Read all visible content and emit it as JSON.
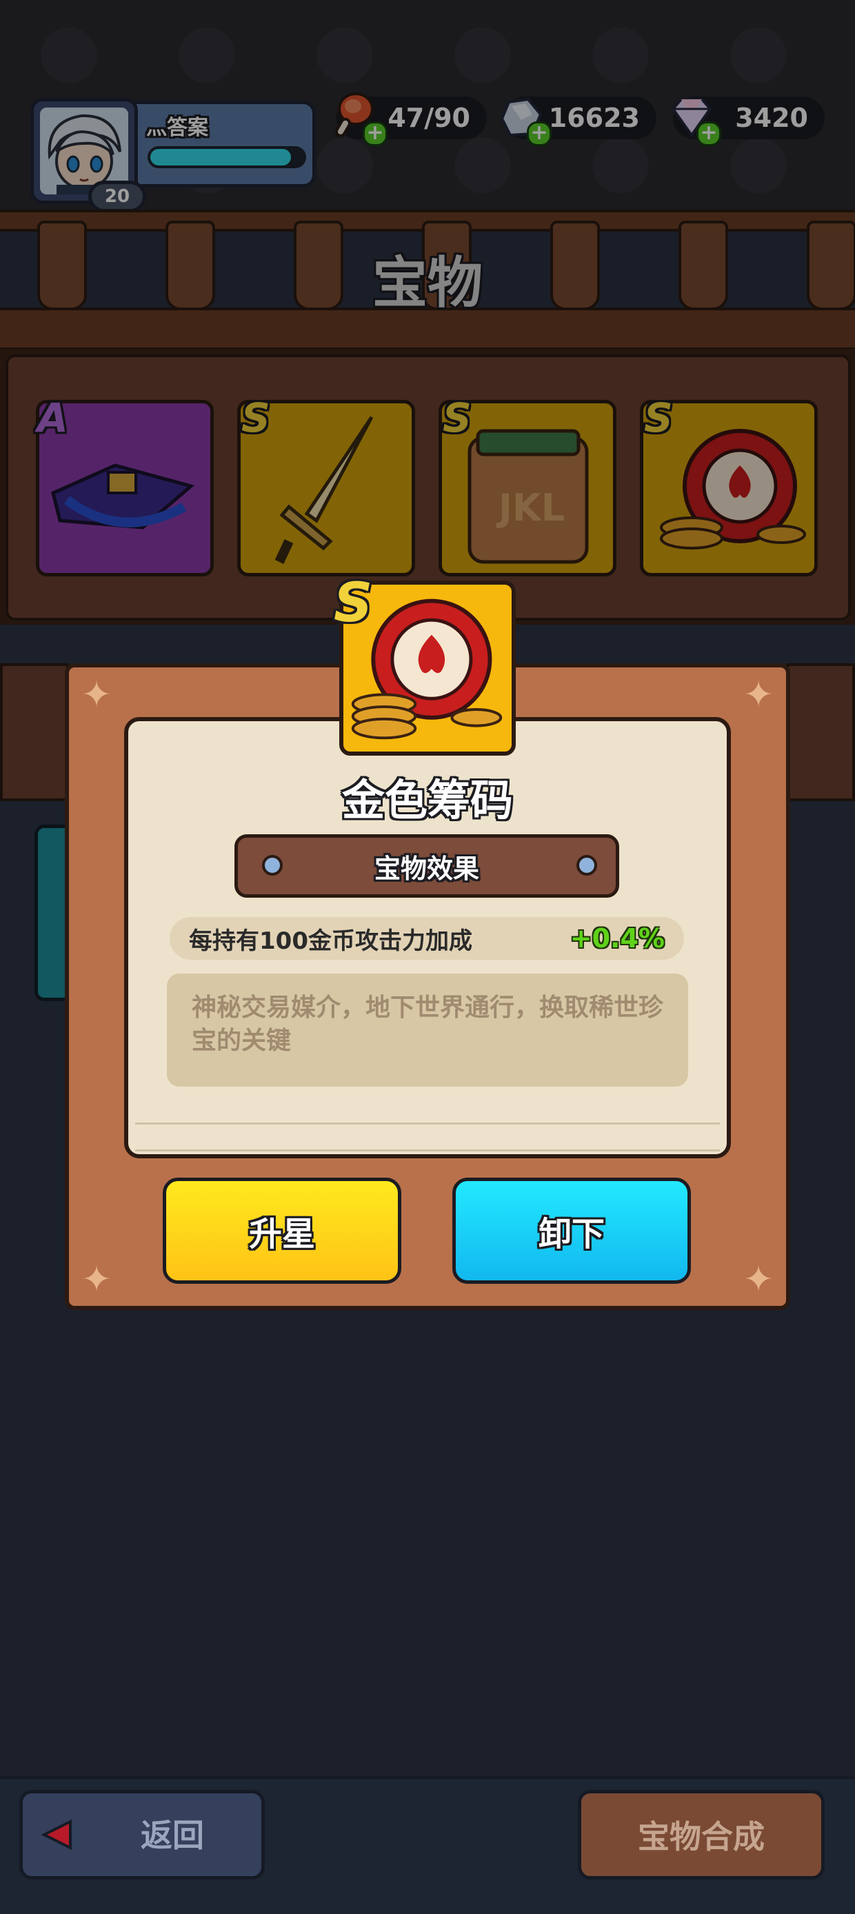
{
  "header": {
    "player_name": "灬答案",
    "player_level": "20",
    "exp_fraction": 0.92,
    "resources": [
      {
        "name": "stamina",
        "icon": "meat-icon",
        "value": "47/90"
      },
      {
        "name": "silver",
        "icon": "silver-ore-icon",
        "value": "16623"
      },
      {
        "name": "diamond",
        "icon": "diamond-icon",
        "value": "3420"
      }
    ],
    "page_title": "宝物"
  },
  "shelf": {
    "items": [
      {
        "grade": "A",
        "icon": "purple-chest-icon"
      },
      {
        "grade": "S",
        "icon": "golden-sword-icon"
      },
      {
        "grade": "S",
        "icon": "jkl-bag-icon",
        "bag_text": "JKL"
      },
      {
        "grade": "S",
        "icon": "golden-chip-icon"
      }
    ]
  },
  "modal": {
    "item_grade": "S",
    "item_icon": "golden-chip-icon",
    "item_name": "金色筹码",
    "effect_header": "宝物效果",
    "effect_text": "每持有100金币攻击力加成",
    "effect_value": "+0.4%",
    "description": "神秘交易媒介，地下世界通行，换取稀世珍宝的关键",
    "upgrade_label": "升星",
    "unequip_label": "卸下"
  },
  "footer": {
    "back_label": "返回",
    "synthesis_label": "宝物合成"
  },
  "colors": {
    "upgrade_button": "#ffd21a",
    "unequip_button": "#1ccdf6",
    "effect_value": "#5fd21a"
  }
}
